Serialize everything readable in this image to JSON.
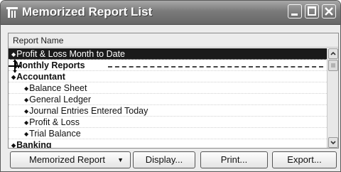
{
  "window": {
    "title": "Memorized Report List",
    "icon": "app-icon",
    "controls": [
      "minimize-icon",
      "maximize-icon",
      "close-icon"
    ]
  },
  "list": {
    "column_header": "Report Name",
    "rows": [
      {
        "label": "Profit & Loss Month to Date",
        "type": "item",
        "selected": true
      },
      {
        "label": "Monthly Reports",
        "type": "group",
        "dragging": true
      },
      {
        "label": "Accountant",
        "type": "group"
      },
      {
        "label": "Balance Sheet",
        "type": "item"
      },
      {
        "label": "General Ledger",
        "type": "item"
      },
      {
        "label": "Journal Entries Entered Today",
        "type": "item"
      },
      {
        "label": "Profit & Loss",
        "type": "item"
      },
      {
        "label": "Trial Balance",
        "type": "item"
      },
      {
        "label": "Banking",
        "type": "group"
      }
    ]
  },
  "buttons": {
    "memorized_report": "Memorized Report",
    "display": "Display...",
    "print": "Print...",
    "export": "Export..."
  },
  "colors": {
    "titlebar": "#7a7a7a",
    "selected_row": "#1a1a1a"
  }
}
